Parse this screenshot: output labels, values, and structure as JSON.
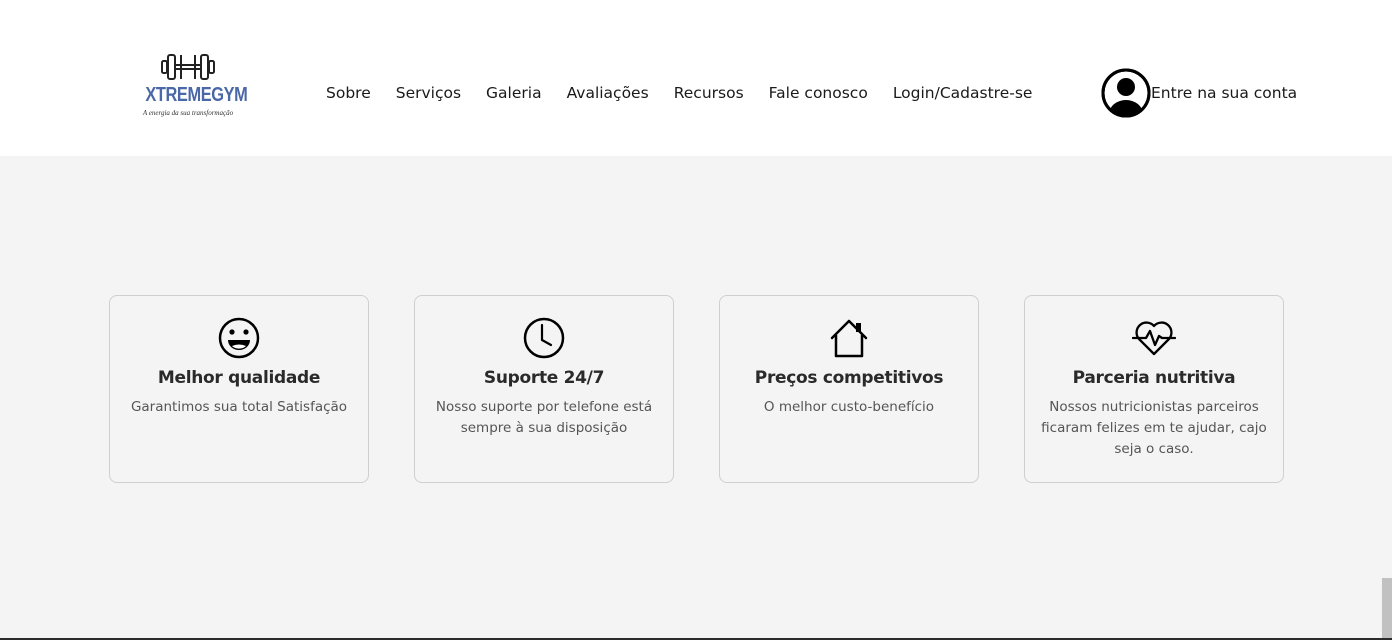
{
  "header": {
    "logo": {
      "icon": "dumbbell-icon",
      "name": "XTREMEGYM",
      "tagline": "A energia da sua transformação"
    },
    "nav": [
      {
        "label": "Sobre"
      },
      {
        "label": "Serviços"
      },
      {
        "label": "Galeria"
      },
      {
        "label": "Avaliações"
      },
      {
        "label": "Recursos"
      },
      {
        "label": "Fale conosco"
      },
      {
        "label": "Login/Cadastre-se"
      }
    ],
    "account": {
      "icon": "user-circle-icon",
      "label": "Entre na sua conta"
    }
  },
  "features": [
    {
      "icon": "smile-icon",
      "title": "Melhor qualidade",
      "description": "Garantimos sua total Satisfação"
    },
    {
      "icon": "clock-icon",
      "title": "Suporte 24/7",
      "description": "Nosso suporte por telefone está sempre à sua disposição"
    },
    {
      "icon": "house-icon",
      "title": "Preços competitivos",
      "description": "O melhor custo-benefício"
    },
    {
      "icon": "heartbeat-icon",
      "title": "Parceria nutritiva",
      "description": "Nossos nutricionistas parceiros ficaram felizes em te ajudar, cajo seja o caso."
    }
  ],
  "colors": {
    "header_bg": "#ffffff",
    "page_bg": "#f4f4f4",
    "brand_blue": "#4a67a8",
    "card_border": "#cfcfcf"
  }
}
